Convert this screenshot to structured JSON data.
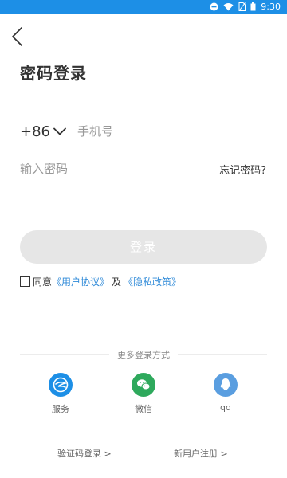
{
  "status_bar": {
    "time": "9:30",
    "bg_color": "#1d8fe6"
  },
  "header": {
    "back_icon": "chevron-left-icon",
    "title": "密码登录"
  },
  "form": {
    "country_code": "+86",
    "phone_placeholder": "手机号",
    "password_placeholder": "输入密码",
    "forgot_label": "忘记密码?",
    "login_label": "登录"
  },
  "agreement": {
    "checked": false,
    "prefix": "同意",
    "user_agreement": "《用户协议》",
    "and": "及",
    "privacy_policy": "《隐私政策》"
  },
  "more_login": {
    "title": "更多登录方式",
    "options": [
      {
        "label": "服务",
        "icon": "service-icon",
        "color": "#1d8fe6"
      },
      {
        "label": "微信",
        "icon": "wechat-icon",
        "color": "#2ea95c"
      },
      {
        "label": "qq",
        "icon": "qq-icon",
        "color": "#5a9ee0"
      }
    ]
  },
  "bottom_links": {
    "sms_login": "验证码登录 >",
    "register": "新用户注册 >"
  },
  "colors": {
    "accent": "#2f8ad8",
    "button_disabled": "#e6e6e6"
  }
}
